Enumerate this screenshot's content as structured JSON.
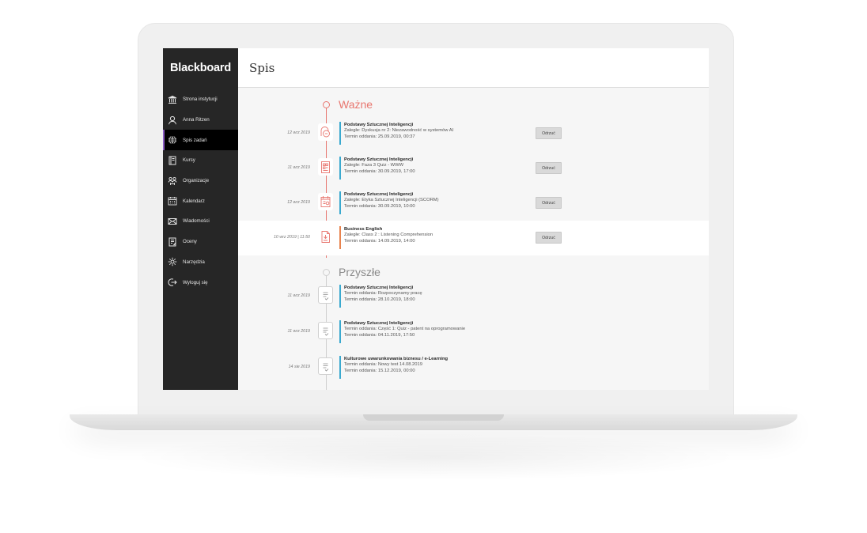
{
  "app": {
    "brand": "Blackboard",
    "page_title": "Spis"
  },
  "sidebar": {
    "items": [
      {
        "label": "Strona instytucji",
        "icon": "institution-icon",
        "active": false
      },
      {
        "label": "Anna Ritzen",
        "icon": "user-icon",
        "active": false
      },
      {
        "label": "Spis zadań",
        "icon": "globe-icon",
        "active": true
      },
      {
        "label": "Kursy",
        "icon": "courses-icon",
        "active": false
      },
      {
        "label": "Organizacje",
        "icon": "organizations-icon",
        "active": false
      },
      {
        "label": "Kalendarz",
        "icon": "calendar-icon",
        "active": false
      },
      {
        "label": "Wiadomości",
        "icon": "mail-icon",
        "active": false
      },
      {
        "label": "Oceny",
        "icon": "grades-icon",
        "active": false
      },
      {
        "label": "Narzędzia",
        "icon": "tools-icon",
        "active": false
      },
      {
        "label": "Wyloguj się",
        "icon": "logout-icon",
        "active": false
      }
    ]
  },
  "colors": {
    "important": "#e8766f",
    "future": "#3aa9cf",
    "accent_business": "#e8834e",
    "active_marker": "#8b5cc4"
  },
  "important": {
    "title": "Ważne",
    "items": [
      {
        "date": "12 wrz 2019",
        "title": "Podstawy Sztucznej Inteligencji",
        "line2": "Zaległe: Dyskusja nr 2: Niezawodność w systemów AI",
        "line3": "Termin oddania: 25.09.2019, 00:37",
        "button": "Odrzuć",
        "icon": "discussion-icon"
      },
      {
        "date": "11 wrz 2019",
        "title": "Podstawy Sztucznej Inteligencji",
        "line2": "Zaległe: Faza 3 Quiz - WWW",
        "line3": "Termin oddania: 30.09.2019, 17:00",
        "button": "Odrzuć",
        "icon": "quiz-icon"
      },
      {
        "date": "12 wrz 2019",
        "title": "Podstawy Sztucznej Inteligencji",
        "line2": "Zaległe: Etyka Sztucznej Inteligencji (SCORM)",
        "line3": "Termin oddania: 30.09.2019, 10:00",
        "button": "Odrzuć",
        "icon": "scorm-icon"
      },
      {
        "date": "10 wrz 2019 | 11:50",
        "title": "Business English",
        "line2": "Zaległe: Class 2 : Listening Comprehension",
        "line3": "Termin oddania: 14.09.2019, 14:00",
        "button": "Odrzuć",
        "icon": "assignment-icon"
      }
    ]
  },
  "future": {
    "title": "Przyszłe",
    "items": [
      {
        "date": "11 wrz 2019",
        "title": "Podstawy Sztucznej Inteligencji",
        "line2": "Termin oddania: Rozpoczynamy pracę",
        "line3": "Termin oddania: 28.10.2019, 18:00",
        "icon": "document-icon"
      },
      {
        "date": "11 wrz 2019",
        "title": "Podstawy Sztucznej Inteligencji",
        "line2": "Termin oddania: Część 1: Quiz - patent na oprogramowanie",
        "line3": "Termin oddania: 04.11.2019, 17:50",
        "icon": "document-icon"
      },
      {
        "date": "14 sie 2019",
        "title": "Kulturowe uwarunkowania biznesu / e-Learning",
        "line2": "Termin oddania: Nowy test 14.08.2019",
        "line3": "Termin oddania: 15.12.2019, 00:00",
        "icon": "document-icon"
      }
    ]
  }
}
